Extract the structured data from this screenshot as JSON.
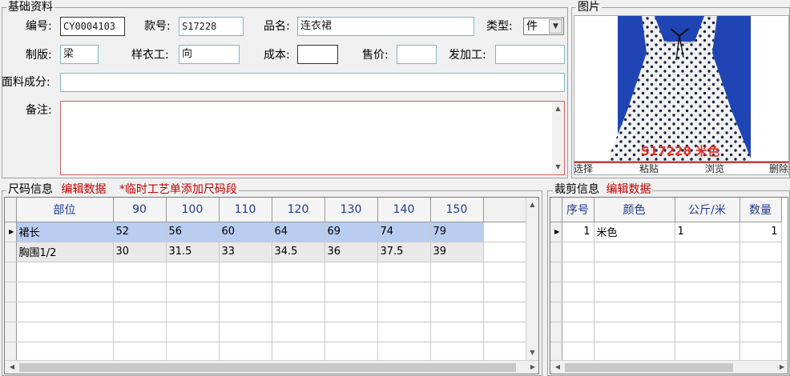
{
  "basic": {
    "title": "基础资料",
    "code_label": "编号:",
    "code_value": "CY0004103",
    "style_label": "款号:",
    "style_value": "S17228",
    "product_label": "品名:",
    "product_value": "连衣裙",
    "type_label": "类型:",
    "type_value": "件",
    "pattern_label": "制版:",
    "pattern_value": "梁",
    "sample_label": "样衣工:",
    "sample_value": "向",
    "cost_label": "成本:",
    "cost_value": "",
    "price_label": "售价:",
    "price_value": "",
    "processor_label": "发加工:",
    "processor_value": "",
    "fabric_label": "面料成分:",
    "fabric_value": "",
    "notes_label": "备注:",
    "notes_value": ""
  },
  "picture": {
    "title": "图片",
    "photo_caption": "S17228 米色",
    "select_label": "选择",
    "paste_label": "粘贴",
    "browse_label": "浏览",
    "delete_label": "删除"
  },
  "size": {
    "title": "尺码信息",
    "edit_label": "编辑数据",
    "note": "*临时工艺单添加尺码段",
    "columns": [
      "部位",
      "90",
      "100",
      "110",
      "120",
      "130",
      "140",
      "150"
    ],
    "rows": [
      [
        "裙长",
        "52",
        "56",
        "60",
        "64",
        "69",
        "74",
        "79"
      ],
      [
        "胸围1/2",
        "30",
        "31.5",
        "33",
        "34.5",
        "36",
        "37.5",
        "39"
      ]
    ]
  },
  "cutting": {
    "title": "裁剪信息",
    "edit_label": "编辑数据",
    "columns": [
      "序号",
      "颜色",
      "公斤/米",
      "数量"
    ],
    "rows": [
      [
        "1",
        "米色",
        "1",
        "1"
      ]
    ]
  },
  "colors": {
    "accent_red": "#c00000",
    "header_blue": "#1f3a8c",
    "selection": "#b9cdf0",
    "field_border": "#7fb7c7"
  }
}
